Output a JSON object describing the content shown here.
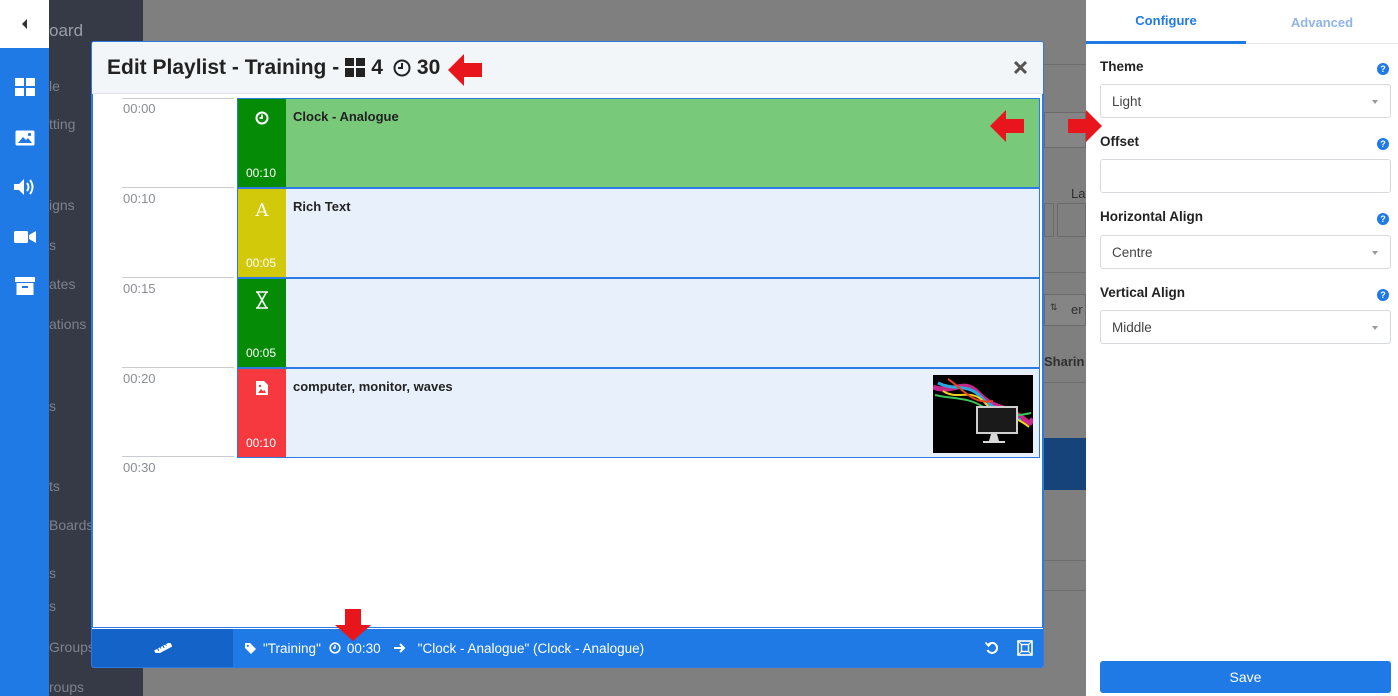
{
  "background_nav": {
    "brand_fragment": "oard",
    "items": [
      "le",
      "tting",
      "igns",
      "s",
      "ates",
      "ations",
      "s",
      "ts",
      "Boards",
      "s",
      "s",
      "Groups",
      "roups"
    ]
  },
  "background_page": {
    "layout_fragment": "Layo",
    "sharing_fragment": "Sharin",
    "select_fragment": "er"
  },
  "modal": {
    "title": "Edit Playlist - Training -",
    "widget_count": "4",
    "duration": "30"
  },
  "timeline": {
    "ticks": [
      "00:00",
      "00:10",
      "00:15",
      "00:20",
      "00:30"
    ],
    "widgets": [
      {
        "name": "Clock - Analogue",
        "duration": "00:10",
        "icon": "clock-icon",
        "color": "#068b06",
        "bg": "#78c97a"
      },
      {
        "name": "Rich Text",
        "duration": "00:05",
        "icon": "text-icon",
        "color": "#d2c90a",
        "bg": "#e8f1fb"
      },
      {
        "name": "",
        "duration": "00:05",
        "icon": "hourglass-icon",
        "color": "#068b06",
        "bg": "#e8f1fb"
      },
      {
        "name": "computer, monitor, waves",
        "duration": "00:10",
        "icon": "image-icon",
        "color": "#f5393f",
        "bg": "#e8f1fb"
      }
    ]
  },
  "footer": {
    "playlist_name": "\"Training\"",
    "duration": "00:30",
    "selected": "\"Clock - Analogue\" (Clock - Analogue)"
  },
  "panel": {
    "tabs": [
      "Configure",
      "Advanced"
    ],
    "theme_label": "Theme",
    "theme_value": "Light",
    "offset_label": "Offset",
    "offset_value": "",
    "halign_label": "Horizontal Align",
    "halign_value": "Centre",
    "valign_label": "Vertical Align",
    "valign_value": "Middle",
    "help_glyph": "?",
    "save_label": "Save"
  },
  "colors": {
    "accent": "#1f7ae6",
    "annotation_arrow": "#e8161c"
  }
}
